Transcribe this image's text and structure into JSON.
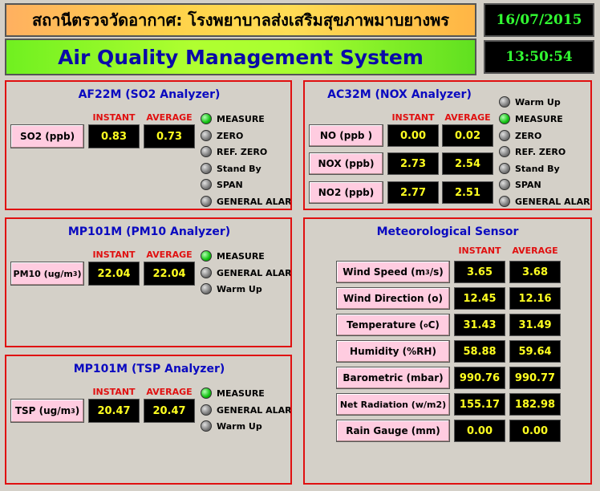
{
  "header": {
    "thai_title": "สถานีตรวจวัดอากาศ: โรงพยาบาลส่งเสริมสุขภาพมาบยางพร",
    "title": "Air Quality Management System",
    "date": "16/07/2015",
    "time": "13:50:54"
  },
  "columns": {
    "instant": "INSTANT",
    "average": "AVERAGE"
  },
  "so2": {
    "title": "AF22M (SO2 Analyzer)",
    "label": "SO2 (ppb)",
    "instant": "0.83",
    "average": "0.73",
    "status": [
      "MEASURE",
      "ZERO",
      "REF. ZERO",
      "Stand By",
      "SPAN",
      "GENERAL ALARM"
    ]
  },
  "nox": {
    "title": "AC32M (NOX Analyzer)",
    "rows": [
      {
        "label": "NO (ppb )",
        "instant": "0.00",
        "average": "0.02"
      },
      {
        "label": "NOX (ppb)",
        "instant": "2.73",
        "average": "2.54"
      },
      {
        "label": "NO2 (ppb)",
        "instant": "2.77",
        "average": "2.51"
      }
    ],
    "status": [
      "Warm Up",
      "MEASURE",
      "ZERO",
      "REF. ZERO",
      "Stand By",
      "SPAN",
      "GENERAL ALARM"
    ]
  },
  "pm10": {
    "title": "MP101M (PM10 Analyzer)",
    "label_main": "PM10 (ug/m",
    "label_sup": "3",
    "label_end": ")",
    "instant": "22.04",
    "average": "22.04",
    "status": [
      "MEASURE",
      "GENERAL ALARM",
      "Warm Up"
    ]
  },
  "tsp": {
    "title": "MP101M (TSP Analyzer)",
    "label_main": "TSP (ug/m",
    "label_sup": "3",
    "label_end": ")",
    "instant": "20.47",
    "average": "20.47",
    "status": [
      "MEASURE",
      "GENERAL ALARM",
      "Warm Up"
    ]
  },
  "met": {
    "title": "Meteorological Sensor",
    "rows": [
      {
        "label": "Wind Speed (m",
        "sup": "3",
        "end": "/s)",
        "instant": "3.65",
        "average": "3.68"
      },
      {
        "label": "Wind Direction (o)",
        "sup": "",
        "end": "",
        "instant": "12.45",
        "average": "12.16"
      },
      {
        "label": "Temperature ( ",
        "sup": "o",
        "end": "C)",
        "instant": "31.43",
        "average": "31.49"
      },
      {
        "label": "Humidity (%RH)",
        "sup": "",
        "end": "",
        "instant": "58.88",
        "average": "59.64"
      },
      {
        "label": "Barometric (mbar)",
        "sup": "",
        "end": "",
        "instant": "990.76",
        "average": "990.77"
      },
      {
        "label": "Net Radiation (w/m2)",
        "sup": "",
        "end": "",
        "instant": "155.17",
        "average": "182.98"
      },
      {
        "label": "Rain Gauge (mm)",
        "sup": "",
        "end": "",
        "instant": "0.00",
        "average": "0.00"
      }
    ]
  }
}
